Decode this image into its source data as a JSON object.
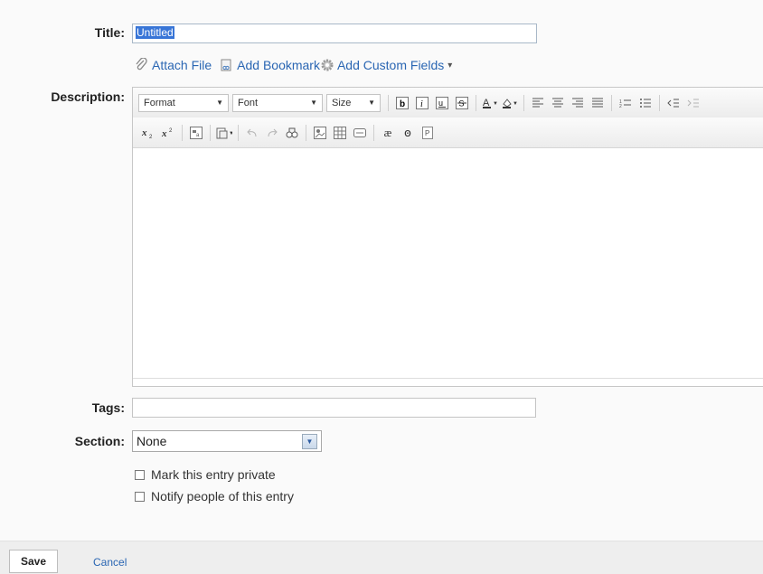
{
  "labels": {
    "title": "Title:",
    "description": "Description:",
    "tags": "Tags:",
    "section": "Section:"
  },
  "title_value": "Untitled",
  "links": {
    "attach_file": "Attach File",
    "add_bookmark": "Add Bookmark",
    "add_custom_fields": "Add Custom Fields"
  },
  "editor": {
    "format_label": "Format",
    "font_label": "Font",
    "size_label": "Size",
    "content": ""
  },
  "tags_value": "",
  "section": {
    "selected": "None"
  },
  "checkboxes": {
    "private_label": "Mark this entry private",
    "notify_label": "Notify people of this entry"
  },
  "footer": {
    "save_label": "Save",
    "cancel_label": "Cancel"
  },
  "colors": {
    "link": "#2a66b3",
    "selection": "#3875d7",
    "footer_bg": "#eeeeee"
  }
}
